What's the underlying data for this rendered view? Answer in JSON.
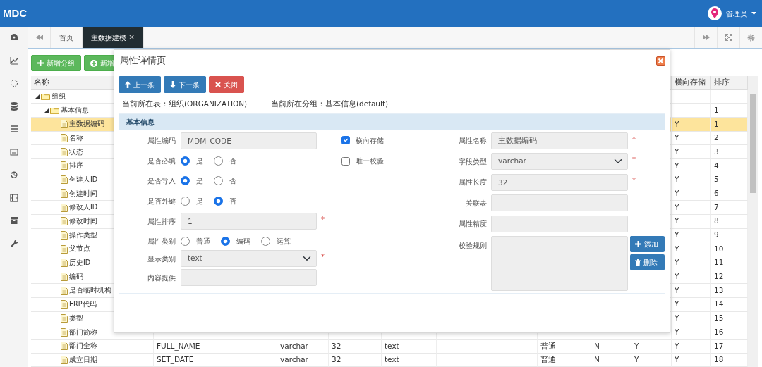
{
  "header": {
    "logo": "MDC",
    "user": "管理员"
  },
  "tabs": [
    {
      "label": "首页",
      "selected": false
    },
    {
      "label": "主数据建模",
      "selected": true,
      "close": "×"
    }
  ],
  "toolbar": [
    {
      "label": "新增分组",
      "kind": "plus"
    },
    {
      "label": "新增",
      "kind": "circle-plus"
    }
  ],
  "table": {
    "columns": [
      "名称",
      null,
      null,
      null,
      null,
      null,
      null,
      null,
      null,
      "横向存储",
      "排序"
    ],
    "rows": [
      {
        "name": "组织",
        "kind": "folder",
        "expanded": true,
        "selected": false,
        "children": [
          {
            "name": "基本信息",
            "kind": "folder",
            "expanded": true,
            "selected": false,
            "cells": [
              null,
              null,
              null,
              null,
              null,
              null,
              null,
              null,
              null,
              "1"
            ],
            "children": [
              {
                "name": "主数据编码",
                "kind": "field",
                "selected": true,
                "cells": [
                  null,
                  null,
                  null,
                  null,
                  null,
                  null,
                  null,
                  null,
                  "Y",
                  "1"
                ]
              },
              {
                "name": "名称",
                "kind": "field",
                "selected": false,
                "cells": [
                  null,
                  null,
                  null,
                  null,
                  null,
                  null,
                  null,
                  null,
                  "Y",
                  "2"
                ]
              },
              {
                "name": "状态",
                "kind": "field",
                "selected": false,
                "cells": [
                  null,
                  null,
                  null,
                  null,
                  null,
                  null,
                  null,
                  null,
                  "Y",
                  "3"
                ]
              },
              {
                "name": "排序",
                "kind": "field",
                "selected": false,
                "cells": [
                  null,
                  null,
                  null,
                  null,
                  null,
                  null,
                  null,
                  null,
                  "Y",
                  "4"
                ]
              },
              {
                "name": "创建人ID",
                "kind": "field",
                "selected": false,
                "cells": [
                  null,
                  null,
                  null,
                  null,
                  null,
                  null,
                  null,
                  null,
                  "Y",
                  "5"
                ]
              },
              {
                "name": "创建时间",
                "kind": "field",
                "selected": false,
                "cells": [
                  null,
                  null,
                  null,
                  null,
                  null,
                  null,
                  null,
                  null,
                  "Y",
                  "6"
                ]
              },
              {
                "name": "修改人ID",
                "kind": "field",
                "selected": false,
                "cells": [
                  null,
                  null,
                  null,
                  null,
                  null,
                  null,
                  null,
                  null,
                  "Y",
                  "7"
                ]
              },
              {
                "name": "修改时间",
                "kind": "field",
                "selected": false,
                "cells": [
                  null,
                  null,
                  null,
                  null,
                  null,
                  null,
                  null,
                  null,
                  "Y",
                  "8"
                ]
              },
              {
                "name": "操作类型",
                "kind": "field",
                "selected": false,
                "cells": [
                  null,
                  null,
                  null,
                  null,
                  null,
                  null,
                  null,
                  null,
                  "Y",
                  "9"
                ]
              },
              {
                "name": "父节点",
                "kind": "field",
                "selected": false,
                "cells": [
                  null,
                  null,
                  null,
                  null,
                  null,
                  null,
                  null,
                  null,
                  "Y",
                  "10"
                ]
              },
              {
                "name": "历史ID",
                "kind": "field",
                "selected": false,
                "cells": [
                  null,
                  null,
                  null,
                  null,
                  null,
                  null,
                  null,
                  null,
                  "Y",
                  "11"
                ]
              },
              {
                "name": "编码",
                "kind": "field",
                "selected": false,
                "cells": [
                  null,
                  null,
                  null,
                  null,
                  null,
                  null,
                  null,
                  null,
                  "Y",
                  "12"
                ]
              },
              {
                "name": "是否临时机构",
                "kind": "field",
                "selected": false,
                "cells": [
                  null,
                  null,
                  null,
                  null,
                  null,
                  null,
                  null,
                  null,
                  "Y",
                  "13"
                ]
              },
              {
                "name": "ERP代码",
                "kind": "field",
                "selected": false,
                "cells": [
                  null,
                  null,
                  null,
                  null,
                  null,
                  null,
                  null,
                  null,
                  "Y",
                  "14"
                ]
              },
              {
                "name": "类型",
                "kind": "field",
                "selected": false,
                "cells": [
                  null,
                  null,
                  null,
                  null,
                  null,
                  null,
                  null,
                  null,
                  "Y",
                  "15"
                ]
              },
              {
                "name": "部门简称",
                "kind": "field",
                "selected": false,
                "cells": [
                  null,
                  null,
                  null,
                  null,
                  null,
                  null,
                  null,
                  null,
                  "Y",
                  "16"
                ]
              },
              {
                "name": "部门全称",
                "kind": "field",
                "selected": false,
                "cells": [
                  "FULL_NAME",
                  "varchar",
                  "32",
                  "text",
                  null,
                  "普通",
                  "N",
                  "Y",
                  "Y",
                  "17"
                ]
              },
              {
                "name": "成立日期",
                "kind": "field",
                "selected": false,
                "cells": [
                  "SET_DATE",
                  "varchar",
                  "32",
                  "text",
                  null,
                  "普通",
                  "N",
                  "Y",
                  "Y",
                  "18"
                ]
              }
            ]
          }
        ]
      }
    ]
  },
  "dialog": {
    "title": "属性详情页",
    "buttons": [
      {
        "label": "上一条",
        "kind": "up"
      },
      {
        "label": "下一条",
        "kind": "down"
      },
      {
        "label": "关闭",
        "kind": "close"
      }
    ],
    "info": [
      "当前所在表：组织(ORGANIZATION)",
      "当前所在分组：基本信息(default)"
    ],
    "section": "基本信息",
    "left_fields": [
      {
        "kind": "input",
        "label": "属性编码",
        "value": "MDM_CODE"
      },
      {
        "kind": "radio",
        "label": "是否必填",
        "options": [
          {
            "label": "是",
            "selected": true
          },
          {
            "label": "否",
            "selected": false
          }
        ]
      },
      {
        "kind": "radio",
        "label": "是否导入",
        "options": [
          {
            "label": "是",
            "selected": true
          },
          {
            "label": "否",
            "selected": false
          }
        ]
      },
      {
        "kind": "radio",
        "label": "是否外键",
        "options": [
          {
            "label": "是",
            "selected": false
          },
          {
            "label": "否",
            "selected": true
          }
        ]
      },
      {
        "kind": "input",
        "label": "属性排序",
        "value": "1",
        "marker": "*"
      },
      {
        "kind": "radio",
        "label": "属性类别",
        "options": [
          {
            "label": "普通",
            "selected": false
          },
          {
            "label": "编码",
            "selected": true
          },
          {
            "label": "运算",
            "selected": false
          }
        ]
      },
      {
        "kind": "select",
        "label": "显示类别",
        "value": "text",
        "marker": "*"
      },
      {
        "kind": "input",
        "label": "内容提供"
      }
    ],
    "checkboxes": [
      {
        "label": "横向存储",
        "checked": true
      },
      {
        "label": "唯一校验",
        "checked": false
      }
    ],
    "right_fields": [
      {
        "kind": "input",
        "label": "属性名称",
        "value": "主数据编码",
        "marker": "*"
      },
      {
        "kind": "select",
        "label": "字段类型",
        "value": "varchar",
        "marker": "*"
      },
      {
        "kind": "input",
        "label": "属性长度",
        "value": "32",
        "marker": "*"
      },
      {
        "kind": "input",
        "label": "关联表"
      },
      {
        "kind": "input",
        "label": "属性精度"
      },
      {
        "kind": "textarea",
        "label": "校验规则",
        "buttons": [
          {
            "label": "添加",
            "kind": "plus"
          },
          {
            "label": "删除",
            "kind": "trash"
          }
        ]
      }
    ]
  }
}
